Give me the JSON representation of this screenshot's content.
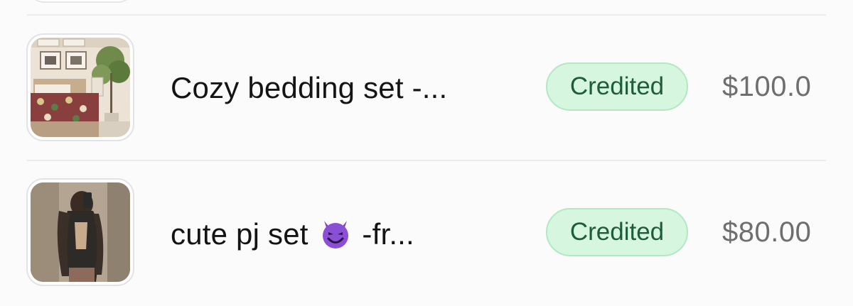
{
  "transactions": [
    {
      "title": "Cozy bedding set -...",
      "status": "Credited",
      "amount": "$100.0",
      "thumbnail": "bedroom-photo"
    },
    {
      "title_text": "cute pj set",
      "title_emoji": "smiling-devil-emoji",
      "title_suffix": "-fr...",
      "status": "Credited",
      "amount": "$80.00",
      "thumbnail": "mirror-selfie-photo"
    }
  ],
  "colors": {
    "badge_bg": "#d6f6df",
    "badge_border": "#b2e8c2",
    "badge_text": "#1f5c39",
    "amount_text": "#6e6e6e",
    "divider": "#ececec"
  }
}
